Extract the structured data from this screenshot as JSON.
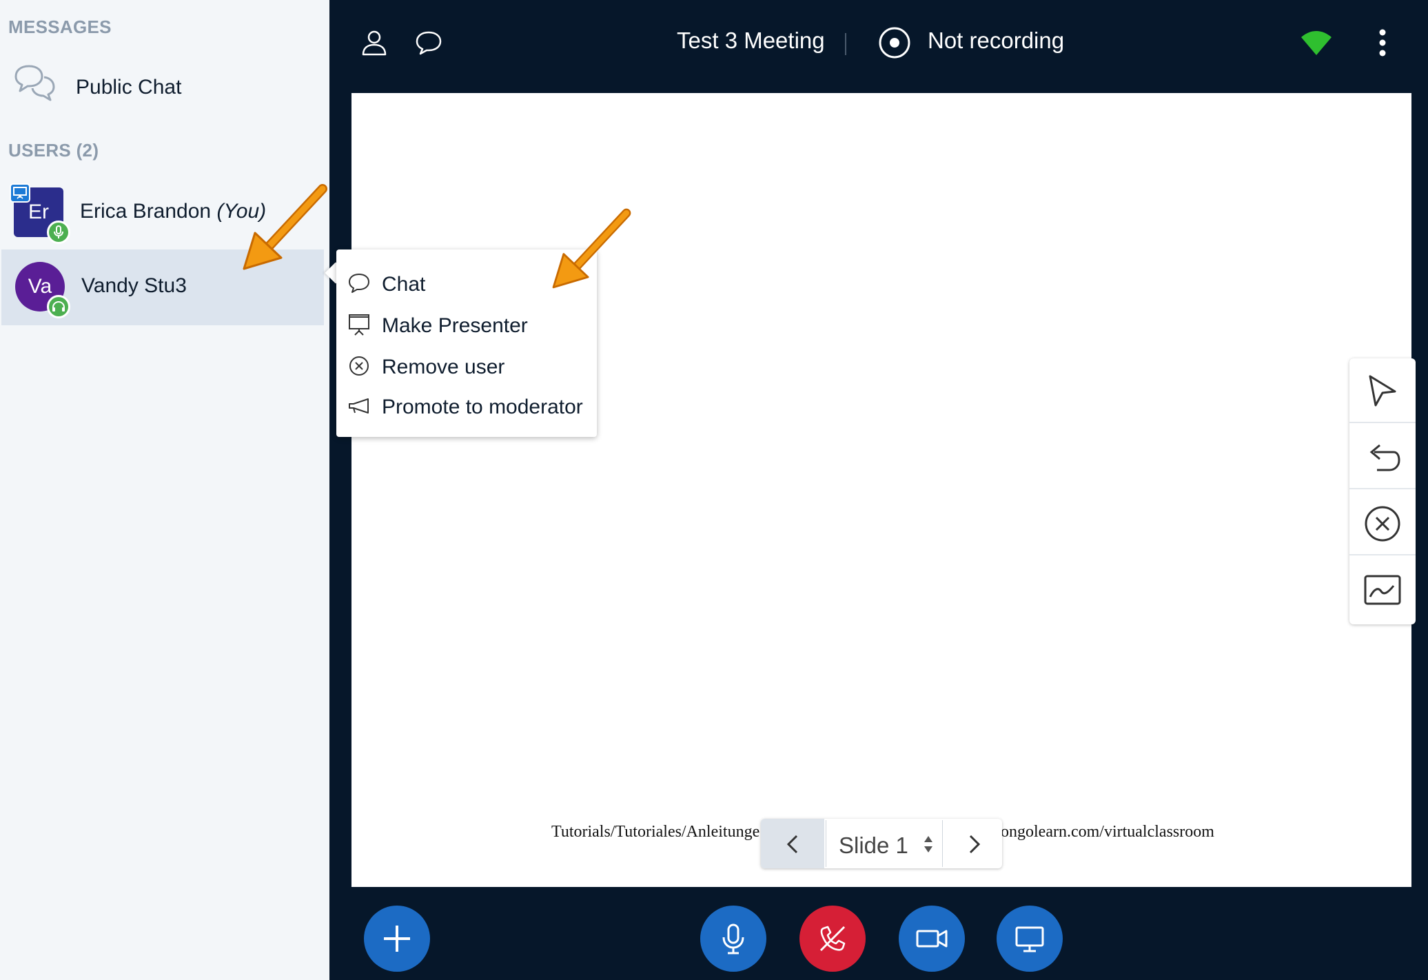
{
  "sidebar": {
    "messages_title": "MESSAGES",
    "public_chat_label": "Public Chat",
    "users_title": "USERS (2)",
    "users": [
      {
        "initials": "Er",
        "name": "Erica Brandon",
        "suffix": "(You)",
        "avatar_color": "#2b2d8c"
      },
      {
        "initials": "Va",
        "name": "Vandy Stu3",
        "suffix": "",
        "avatar_color": "#5a1e96"
      }
    ]
  },
  "topbar": {
    "meeting_title": "Test 3 Meeting",
    "separator": "|",
    "recording_status": "Not recording"
  },
  "context_menu": {
    "items": [
      {
        "label": "Chat",
        "icon": "chat-bubble-icon"
      },
      {
        "label": "Make Presenter",
        "icon": "presentation-board-icon"
      },
      {
        "label": "Remove user",
        "icon": "remove-circle-icon"
      },
      {
        "label": "Promote to moderator",
        "icon": "megaphone-icon"
      }
    ]
  },
  "slide": {
    "footer_left": "Tutorials/Tutoriales/Anleitunge",
    "footer_right": "ongolearn.com/virtualclassroom",
    "current_slide": "Slide 1"
  },
  "whiteboard_tools": [
    "pointer-icon",
    "undo-icon",
    "clear-icon",
    "multi-user-icon"
  ],
  "actions": [
    "add-icon",
    "microphone-icon",
    "hang-up-icon",
    "camera-icon",
    "screen-share-icon"
  ],
  "colors": {
    "dark_bg": "#06172a",
    "accent_blue": "#1c6bc4",
    "leave_red": "#d61f36",
    "status_green": "#4caf50",
    "annotation_orange": "#f08a00"
  }
}
